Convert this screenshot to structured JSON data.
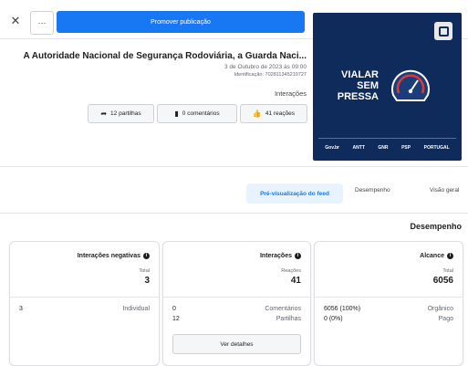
{
  "header": {
    "promote_label": "Promover publicação",
    "more_label": "···",
    "close_label": "✕"
  },
  "post": {
    "image_text": "VIALAR SEM PRESSA",
    "logos": [
      "Gov.br",
      "ANTT",
      "GNR",
      "PSP",
      "PORTUGAL"
    ],
    "title": "A Autoridade Nacional de Segurança Rodoviária, a Guarda Naci...",
    "date": "3 de Outubro de 2023 às 09:00",
    "identifier": "Identificação: 702811345210727",
    "interactions_heading": "Interações",
    "reactions_label": "41 reações",
    "comments_label": "0 comentários",
    "shares_label": "12 partilhas"
  },
  "tabs": {
    "overview": "Visão geral",
    "performance": "Desempenho",
    "preview": "Pré-visualização do feed"
  },
  "performance": {
    "title": "Desempenho",
    "reach": {
      "title": "Alcance",
      "sub": "Total",
      "value": "6056",
      "rows": [
        {
          "label": "Orgânico",
          "value": "6056 (100%)"
        },
        {
          "label": "Pago",
          "value": "0 (0%)"
        }
      ]
    },
    "interactions": {
      "title": "Interações",
      "sub": "Reações",
      "value": "41",
      "rows": [
        {
          "label": "Comentários",
          "value": "0"
        },
        {
          "label": "Partilhas",
          "value": "12"
        }
      ],
      "details_label": "Ver detalhes"
    },
    "negative": {
      "title": "Interações negativas",
      "sub": "Total",
      "value": "3",
      "rows": [
        {
          "label": "Individual",
          "value": "3"
        }
      ]
    }
  },
  "colors": {
    "accent": "#1877f2",
    "image_bg": "#0e2b5c",
    "tab_active_bg": "#e7f3ff"
  }
}
